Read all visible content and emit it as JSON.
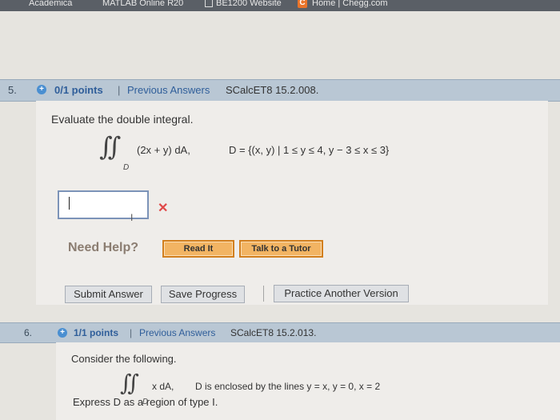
{
  "bookmarks": [
    {
      "label": "Academica"
    },
    {
      "label": "MATLAB Online R20"
    },
    {
      "label": "BE1200 Website"
    },
    {
      "label": "Home | Chegg.com"
    }
  ],
  "questions": [
    {
      "number": "5.",
      "points": "0/1 points",
      "separator": "|",
      "history_link": "Previous Answers",
      "reference": "SCalcET8 15.2.008.",
      "prompt": "Evaluate the double integral.",
      "integral_symbol": "∬",
      "integral_domain": "D",
      "integrand": "(2x + y) dA,",
      "region": "D = {(x, y) | 1 ≤ y ≤ 4, y − 3 ≤ x ≤ 3}",
      "answer_value": "",
      "result": "incorrect",
      "help_label": "Need Help?",
      "read_it_label": "Read It",
      "tutor_label": "Talk to a Tutor",
      "submit_label": "Submit Answer",
      "save_label": "Save Progress",
      "practice_label": "Practice Another Version"
    },
    {
      "number": "6.",
      "points": "1/1 points",
      "separator": "|",
      "history_link": "Previous Answers",
      "reference": "SCalcET8 15.2.013.",
      "prompt": "Consider the following.",
      "integral_symbol": "∬",
      "integral_domain": "D",
      "integrand": "x dA,",
      "region": "D is enclosed by the lines y = x, y = 0, x = 2",
      "type_prompt": "Express D as a region of type I."
    }
  ],
  "colors": {
    "header_bg": "#b9c7d4",
    "link": "#2f5e9a",
    "incorrect": "#e04848",
    "button_orange": "#f2b463"
  },
  "icons": {
    "status": "plus-circle-icon",
    "incorrect": "x-mark-icon",
    "bookmark": "chegg-icon"
  }
}
